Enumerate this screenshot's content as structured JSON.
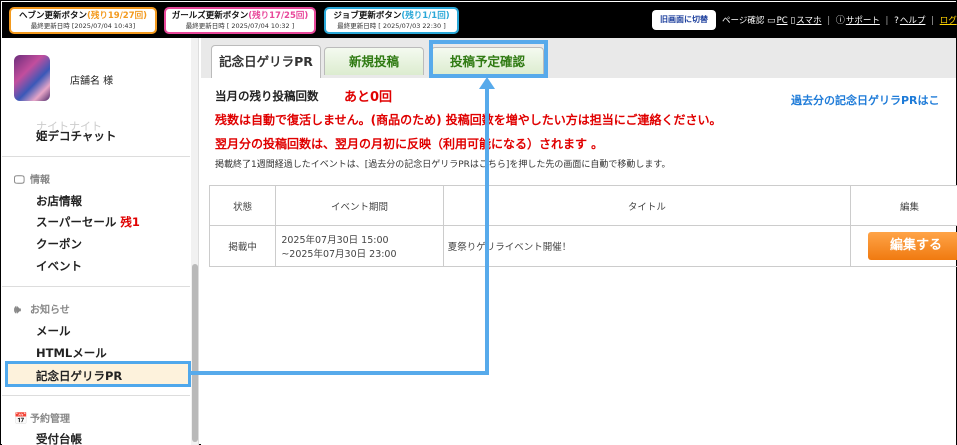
{
  "topbar": {
    "buttons": [
      {
        "label": "ヘブン更新ボタン",
        "remaining": "(残り19/27回)",
        "updated": "最終更新日時 [2025/07/04 10:43]",
        "accent": "#f39a1e",
        "remain_color": "#f39a1e"
      },
      {
        "label": "ガールズ更新ボタン",
        "remaining": "(残り17/25回)",
        "updated": "最終更新日時 [ 2025/07/04 10:32 ]",
        "accent": "#e8479a",
        "remain_color": "#e8479a"
      },
      {
        "label": "ジョブ更新ボタン",
        "remaining": "(残り1/1回)",
        "updated": "最終更新日時 [ 2025/07/03 22:30 ]",
        "accent": "#2aa8d8",
        "remain_color": "#2aa8d8"
      }
    ],
    "old_screen": "旧画面に切替",
    "page_check": "ページ確認",
    "pc": "PC",
    "smartphone": "スマホ",
    "support": "サポート",
    "help": "ヘルプ",
    "logout": "ログ"
  },
  "sidebar": {
    "shop_name": "店舗名 様",
    "faded_item": "ナイトナイト",
    "deco_chat": "姫デコチャット",
    "sections": {
      "info": "情報",
      "notice": "お知らせ",
      "reserve": "予約管理"
    },
    "items": {
      "shop_info": "お店情報",
      "super_sale": "スーパーセール",
      "super_sale_badge": "残1",
      "coupon": "クーポン",
      "event": "イベント",
      "mail": "メール",
      "html_mail": "HTMLメール",
      "guerrilla": "記念日ゲリラPR",
      "reception": "受付台帳"
    },
    "icons": {
      "info": "monitor-icon",
      "notice": "speaker-icon",
      "reserve": "calendar-icon"
    }
  },
  "main": {
    "tabs": {
      "current": "記念日ゲリラPR",
      "new_post": "新規投稿",
      "scheduled": "投稿予定確認"
    },
    "count_label": "当月の残り投稿回数",
    "count_remaining": "あと0回",
    "past_link": "過去分の記念日ゲリラPRはこ",
    "notice_1": "残数は自動で復活しません。(商品のため) 投稿回数を増やしたい方は担当にご連絡ください。",
    "notice_2": "翌月分の投稿回数は、翌月の月初に反映（利用可能になる）されます 。",
    "note": "掲載終了1週間経過したイベントは、[過去分の記念日ゲリラPRはこちら]を押した先の画面に自動で移動します。",
    "table": {
      "headers": [
        "状態",
        "イベント期間",
        "タイトル",
        "編集"
      ],
      "rows": [
        {
          "status": "掲載中",
          "period_start": "2025年07月30日 15:00",
          "period_end": "~2025年07月30日 23:00",
          "title": "夏祭りゲリライベント開催！",
          "edit": "編集する"
        }
      ]
    }
  },
  "colors": {
    "highlight": "#57aaeb",
    "alert_red": "#e00000",
    "tab_green": "#2f7a12",
    "link_blue": "#1e7bd8",
    "edit_orange": "#f07a10"
  }
}
